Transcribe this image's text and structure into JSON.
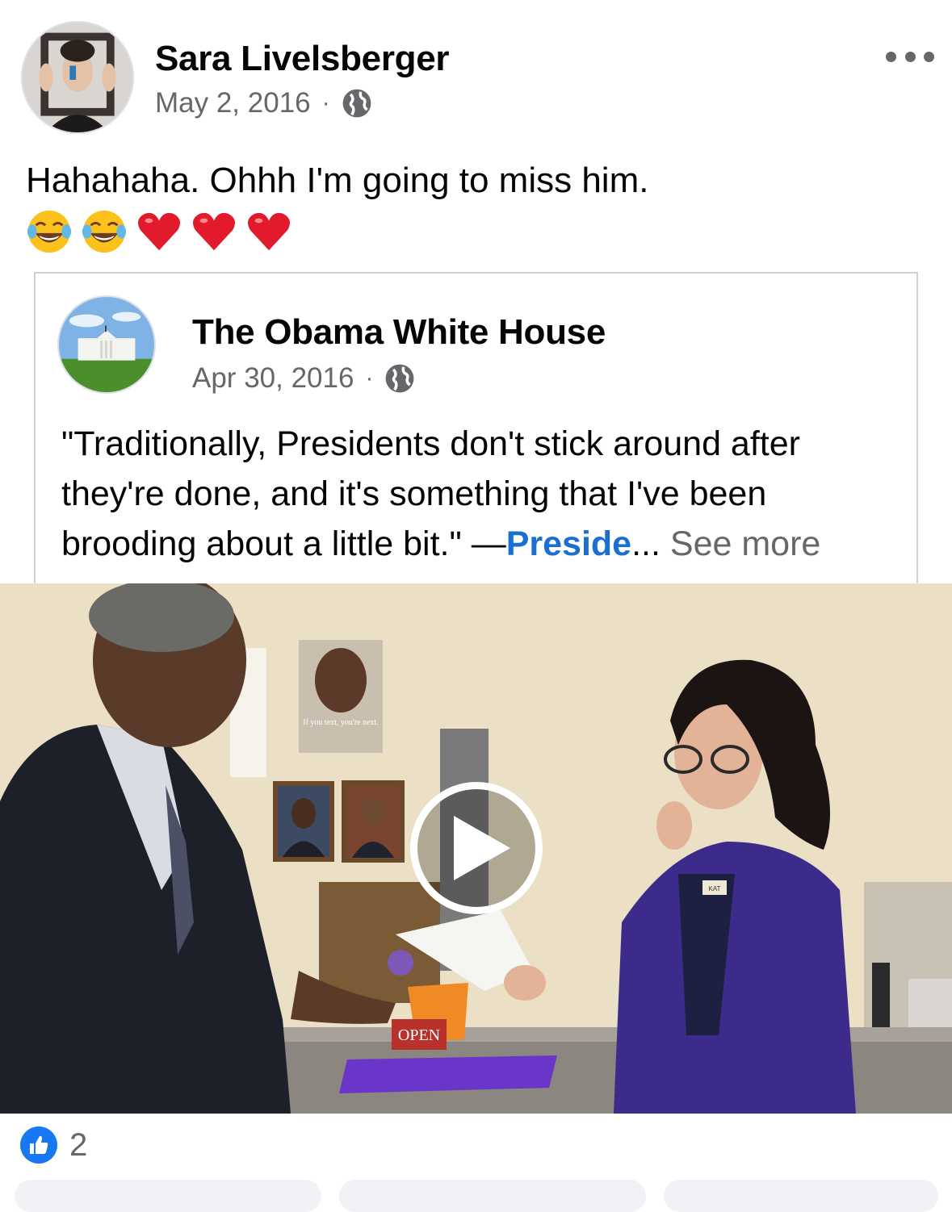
{
  "post": {
    "author": "Sara Livelsberger",
    "date": "May 2, 2016",
    "separator": "·",
    "audience_icon": "globe-icon",
    "text": "Hahahaha. Ohhh I'm going to miss him.",
    "emojis": [
      "face-with-tears-of-joy",
      "face-with-tears-of-joy",
      "red-heart",
      "red-heart",
      "red-heart"
    ]
  },
  "shared_post": {
    "page_name": "The Obama White House",
    "date": "Apr 30, 2016",
    "separator": "·",
    "audience_icon": "globe-icon",
    "quote_text": "\"Traditionally, Presidents don't stick around after they're done, and it's something that I've been brooding about a little bit.\" —",
    "link_text": "Preside",
    "ellipsis": "...",
    "see_more": "See more"
  },
  "video": {
    "play_icon": "play-icon",
    "poster_text": "If you text, you're next.",
    "sign_text": "OPEN",
    "badge_text": "KAT"
  },
  "reactions": {
    "icon": "like-icon",
    "count": "2"
  },
  "colors": {
    "link": "#1b6fd1",
    "meta_gray": "#65676b",
    "like_blue": "#1877f2"
  }
}
